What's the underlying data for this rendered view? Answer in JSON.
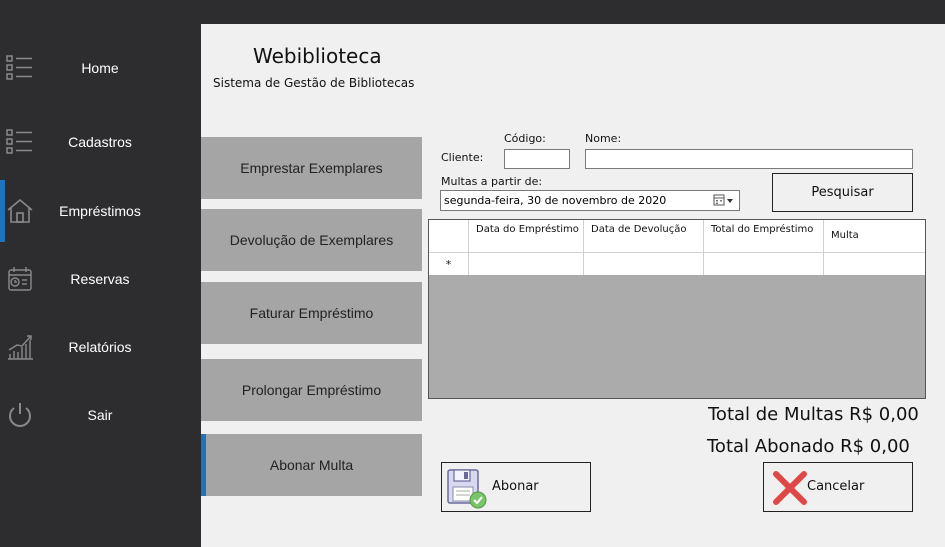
{
  "sidebar": {
    "items": [
      {
        "label": "Home",
        "icon": "list-icon",
        "active": false
      },
      {
        "label": "Cadastros",
        "icon": "list-icon",
        "active": false
      },
      {
        "label": "Empréstimos",
        "icon": "house-icon",
        "active": true
      },
      {
        "label": "Reservas",
        "icon": "calendar-icon",
        "active": false
      },
      {
        "label": "Relatórios",
        "icon": "chart-icon",
        "active": false
      },
      {
        "label": "Sair",
        "icon": "power-icon",
        "active": false
      }
    ]
  },
  "header": {
    "title": "Webiblioteca",
    "subtitle": "Sistema de Gestão de Bibliotecas"
  },
  "submenu": [
    {
      "label": "Emprestar Exemplares",
      "active": false
    },
    {
      "label": "Devolução de Exemplares",
      "active": false
    },
    {
      "label": "Faturar Empréstimo",
      "active": false
    },
    {
      "label": "Prolongar Empréstimo",
      "active": false
    },
    {
      "label": "Abonar Multa",
      "active": true
    }
  ],
  "form": {
    "client_label": "Cliente:",
    "code_label": "Código:",
    "code_value": "",
    "name_label": "Nome:",
    "name_value": "",
    "fines_from_label": "Multas a partir de:",
    "date_value": "segunda-feira, 30 de novembro de 2020",
    "search_button": "Pesquisar"
  },
  "grid": {
    "columns": [
      "Data do Empréstimo",
      "Data de Devolução",
      "Total do Empréstimo",
      "Multa"
    ],
    "new_row_marker": "*"
  },
  "totals": {
    "fines": "Total de Multas R$ 0,00",
    "waived": "Total Abonado R$ 0,00"
  },
  "actions": {
    "waive_button": "Abonar",
    "cancel_button": "Cancelar"
  },
  "colors": {
    "sidebar_bg": "#2d2d30",
    "accent": "#1e73be",
    "submenu_bg": "#a5a5a5",
    "content_bg": "#f0f0f0"
  }
}
